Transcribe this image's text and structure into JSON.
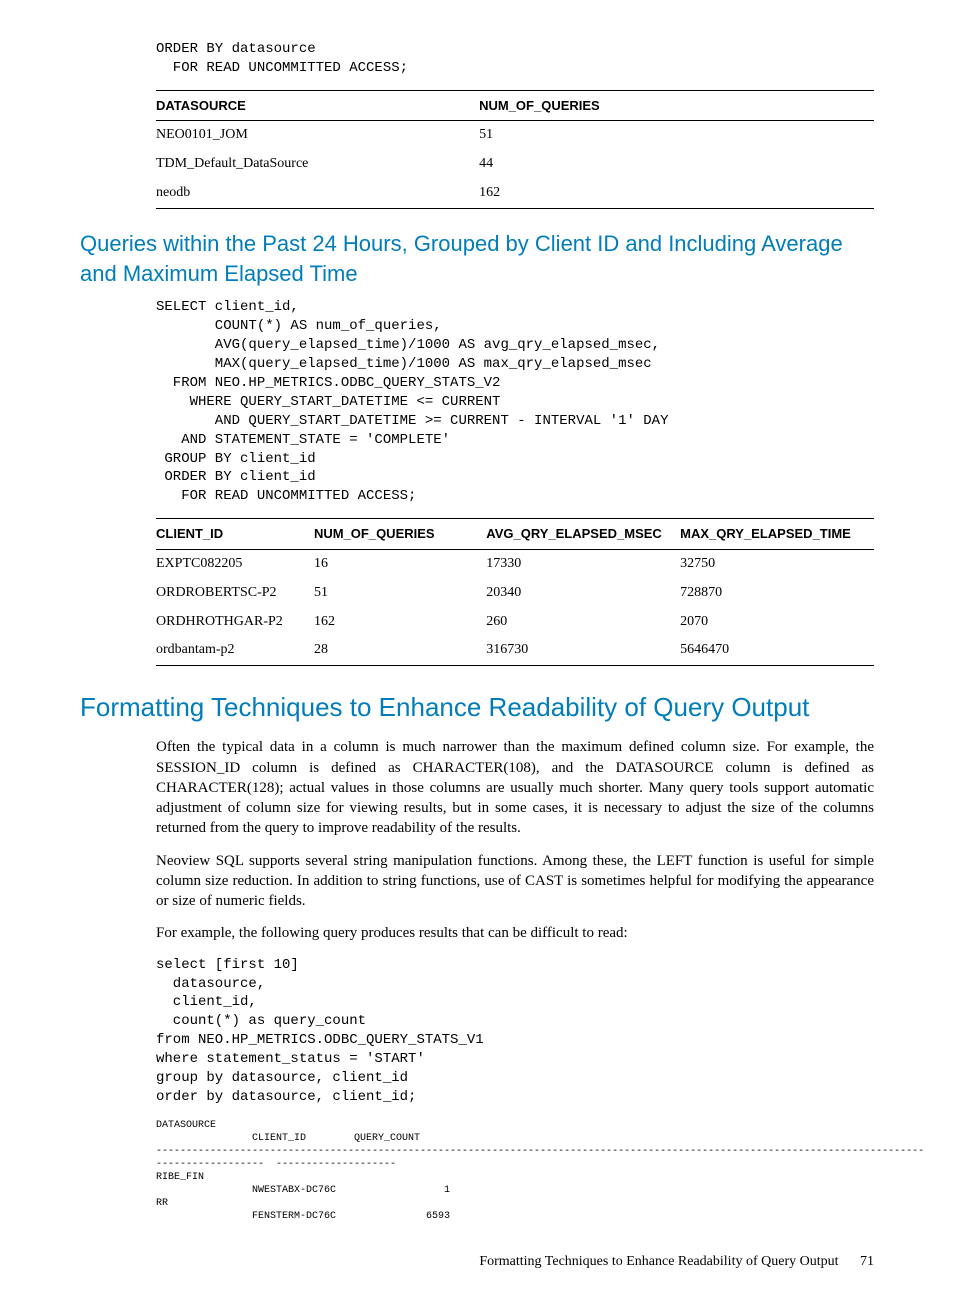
{
  "code1": "ORDER BY datasource\n  FOR READ UNCOMMITTED ACCESS;",
  "table1": {
    "headers": [
      "DATASOURCE",
      "NUM_OF_QUERIES"
    ],
    "rows": [
      [
        "NEO0101_JOM",
        "51"
      ],
      [
        "TDM_Default_DataSource",
        "44"
      ],
      [
        "neodb",
        "162"
      ]
    ]
  },
  "heading2": "Queries within the Past 24 Hours, Grouped by Client ID and Including Average and Maximum Elapsed Time",
  "code2": "SELECT client_id,\n       COUNT(*) AS num_of_queries,\n       AVG(query_elapsed_time)/1000 AS avg_qry_elapsed_msec,\n       MAX(query_elapsed_time)/1000 AS max_qry_elapsed_msec\n  FROM NEO.HP_METRICS.ODBC_QUERY_STATS_V2\n    WHERE QUERY_START_DATETIME <= CURRENT\n       AND QUERY_START_DATETIME >= CURRENT - INTERVAL '1' DAY\n   AND STATEMENT_STATE = 'COMPLETE'\n GROUP BY client_id\n ORDER BY client_id\n   FOR READ UNCOMMITTED ACCESS;",
  "table2": {
    "headers": [
      "CLIENT_ID",
      "NUM_OF_QUERIES",
      "AVG_QRY_ELAPSED_MSEC",
      "MAX_QRY_ELAPSED_TIME"
    ],
    "rows": [
      [
        "EXPTC082205",
        "16",
        "17330",
        "32750"
      ],
      [
        "ORDROBERTSC-P2",
        "51",
        "20340",
        "728870"
      ],
      [
        "ORDHROTHGAR-P2",
        "162",
        "260",
        "2070"
      ],
      [
        "ordbantam-p2",
        "28",
        "316730",
        "5646470"
      ]
    ]
  },
  "heading1": "Formatting Techniques to Enhance Readability of Query Output",
  "para1": "Often the typical data in a column is much narrower than the maximum defined column size. For example, the SESSION_ID column is defined as CHARACTER(108), and the DATASOURCE column is defined as CHARACTER(128); actual values in those columns are usually much shorter. Many query tools support automatic adjustment of column size for viewing results, but in some cases, it is necessary to adjust the size of the columns returned from the query to improve readability of the results.",
  "para2": "Neoview SQL supports several string manipulation functions. Among these, the LEFT function is useful for simple column size reduction. In addition to string functions, use of CAST is sometimes helpful for modifying the appearance or size of numeric fields.",
  "para3": "For example, the following query produces results that can be difficult to read:",
  "code3": "select [first 10]\n  datasource,\n  client_id,\n  count(*) as query_count\nfrom NEO.HP_METRICS.ODBC_QUERY_STATS_V1\nwhere statement_status = 'START'\ngroup by datasource, client_id\norder by datasource, client_id;",
  "output1": "DATASOURCE\n                CLIENT_ID        QUERY_COUNT\n--------------------------------------------------------------------------------------------------------------------------------\n------------------  --------------------\nRIBE_FIN\n                NWESTABX-DC76C                  1\nRR\n                FENSTERM-DC76C               6593",
  "footer_text": "Formatting Techniques to Enhance Readability of Query Output",
  "footer_page": "71"
}
